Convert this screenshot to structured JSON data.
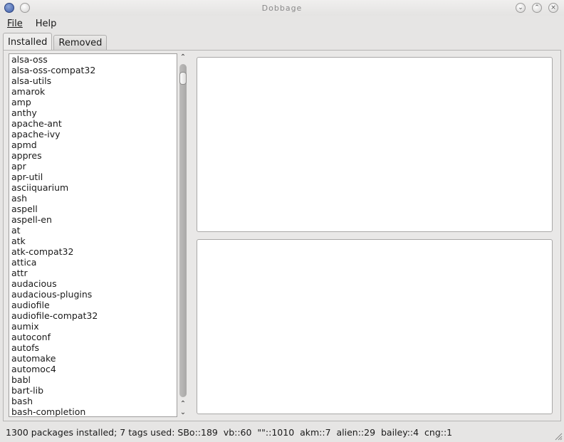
{
  "window": {
    "title": "Dobbage"
  },
  "menu": {
    "file": "File",
    "help": "Help"
  },
  "tabs": [
    {
      "label": "Installed"
    },
    {
      "label": "Removed"
    }
  ],
  "packages": [
    "alsa-oss",
    "alsa-oss-compat32",
    "alsa-utils",
    "amarok",
    "amp",
    "anthy",
    "apache-ant",
    "apache-ivy",
    "apmd",
    "appres",
    "apr",
    "apr-util",
    "asciiquarium",
    "ash",
    "aspell",
    "aspell-en",
    "at",
    "atk",
    "atk-compat32",
    "attica",
    "attr",
    "audacious",
    "audacious-plugins",
    "audiofile",
    "audiofile-compat32",
    "aumix",
    "autoconf",
    "autofs",
    "automake",
    "automoc4",
    "babl",
    "bart-lib",
    "bash",
    "bash-completion"
  ],
  "status": {
    "text": "1300 packages installed; 7 tags used: SBo::189  vb::60  \"\"::1010  akm::7  alien::29  bailey::4  cng::1"
  }
}
